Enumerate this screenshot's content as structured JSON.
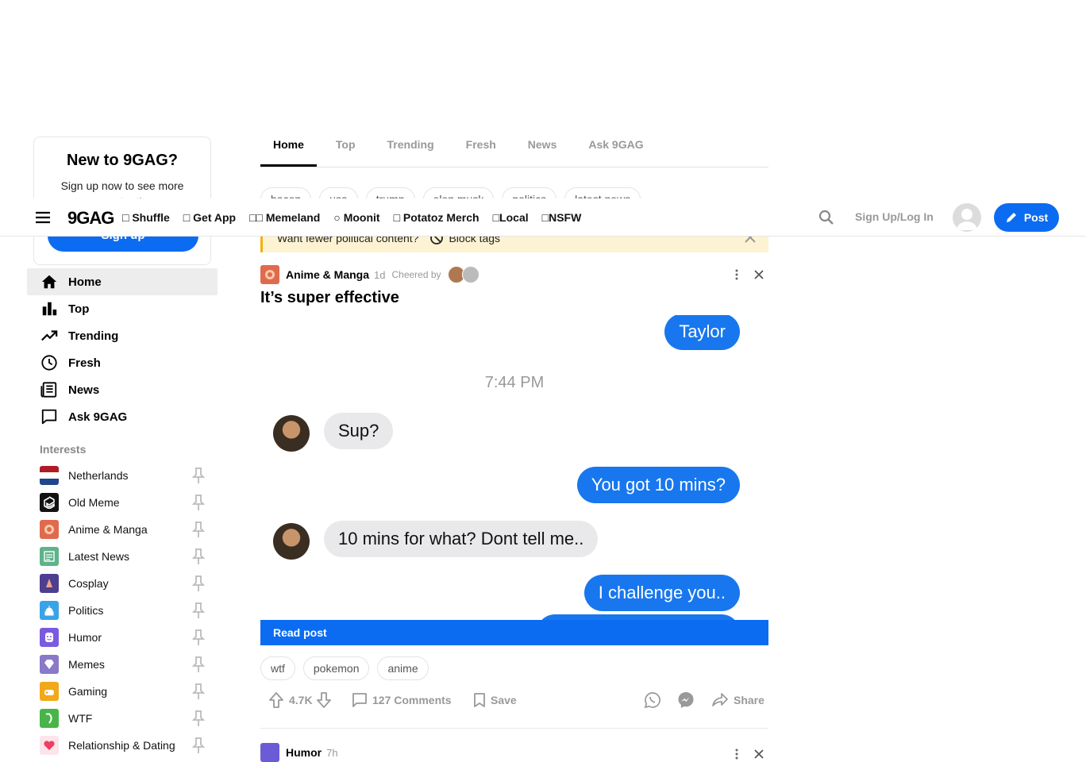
{
  "header": {
    "logo": "9GAG",
    "nav": [
      {
        "label": "□ Shuffle"
      },
      {
        "label": "□ Get App"
      },
      {
        "label": "□□ Memeland"
      },
      {
        "label": "○ Moonit"
      },
      {
        "label": "□ Potatoz Merch"
      },
      {
        "label": "□Local"
      },
      {
        "label": "□NSFW"
      }
    ],
    "login_label": "Sign Up/Log In",
    "post_label": "Post"
  },
  "signup": {
    "title": "New to 9GAG?",
    "text": "Sign up now to see more content!",
    "button": "Sign up"
  },
  "sidebar": {
    "items": [
      {
        "label": "Home",
        "icon": "home-icon"
      },
      {
        "label": "Top",
        "icon": "bar-chart-icon"
      },
      {
        "label": "Trending",
        "icon": "trending-icon"
      },
      {
        "label": "Fresh",
        "icon": "clock-icon"
      },
      {
        "label": "News",
        "icon": "newspaper-icon"
      },
      {
        "label": "Ask 9GAG",
        "icon": "chat-icon"
      }
    ],
    "interests_title": "Interests",
    "interests": [
      {
        "label": "Netherlands",
        "color": "#ae1c28"
      },
      {
        "label": "Old Meme",
        "color": "#111111"
      },
      {
        "label": "Anime & Manga",
        "color": "#e06a4e"
      },
      {
        "label": "Latest News",
        "color": "#5fb38a"
      },
      {
        "label": "Cosplay",
        "color": "#4d3f8f"
      },
      {
        "label": "Politics",
        "color": "#3aa3e8"
      },
      {
        "label": "Humor",
        "color": "#7a5ae0"
      },
      {
        "label": "Memes",
        "color": "#8a78c9"
      },
      {
        "label": "Gaming",
        "color": "#f0a81c"
      },
      {
        "label": "WTF",
        "color": "#47b548"
      },
      {
        "label": "Relationship & Dating",
        "color": "#f4aebf"
      }
    ]
  },
  "tabs": [
    {
      "label": "Home"
    },
    {
      "label": "Top"
    },
    {
      "label": "Trending"
    },
    {
      "label": "Fresh"
    },
    {
      "label": "News"
    },
    {
      "label": "Ask 9GAG"
    }
  ],
  "trending_tags": [
    "bacon",
    "usa",
    "trump",
    "elon musk",
    "politics",
    "latest news"
  ],
  "political_bar": {
    "text": "Want fewer political content?",
    "action": "Block tags"
  },
  "post": {
    "section": "Anime & Manga",
    "age": "1d",
    "cheered_by": "Cheered by",
    "title": "It’s super effective",
    "chat": {
      "taylor": "Taylor",
      "time": "7:44 PM",
      "msg1": "Sup?",
      "msg2": "You got 10 mins?",
      "msg3": "10 mins for what? Dont tell me..",
      "msg4": "I challenge you.."
    },
    "read_post": "Read post",
    "tags": [
      "wtf",
      "pokemon",
      "anime"
    ],
    "upvotes": "4.7K",
    "comments": "127 Comments",
    "save": "Save",
    "share": "Share"
  },
  "next_post": {
    "section": "Humor",
    "age": "7h"
  },
  "colors": {
    "accent": "#0b6cf1",
    "warning_bg": "#fdf3d3",
    "warning_border": "#f2b10c"
  }
}
